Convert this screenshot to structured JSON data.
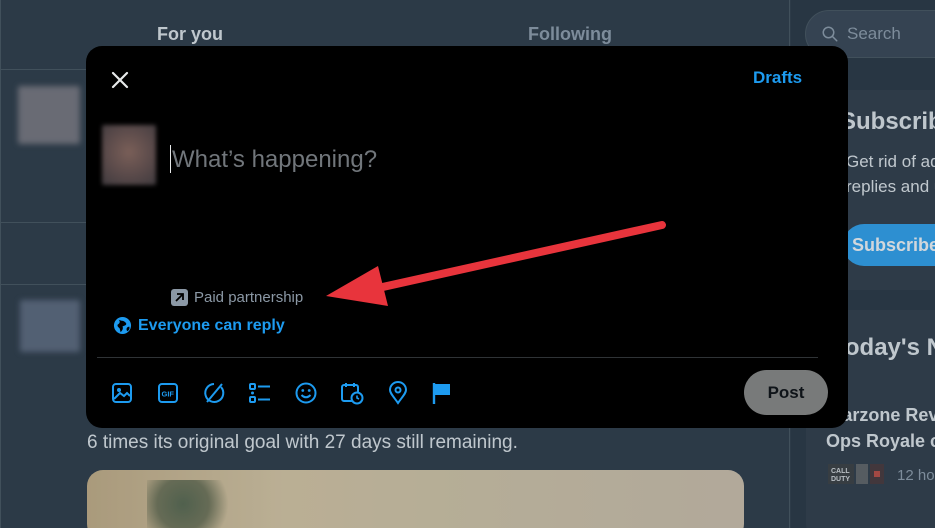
{
  "timeline": {
    "tabs": [
      {
        "label": "For you"
      },
      {
        "label": "Following"
      }
    ],
    "post_text": "6 times its original goal with 27 days still remaining."
  },
  "sidebar": {
    "search_placeholder": "Search",
    "subscribe": {
      "title": "Subscribe",
      "line1": "Get rid of ad",
      "line2": "replies and u",
      "button": "Subscribe"
    },
    "today": {
      "title": "Today's N",
      "headline1": "Warzone Rev",
      "headline2": "Ops Royale c",
      "meta": "12 ho"
    }
  },
  "compose": {
    "drafts_label": "Drafts",
    "placeholder": "What’s happening?",
    "paid_partnership": "Paid partnership",
    "reply_setting": "Everyone can reply",
    "post_button": "Post",
    "toolbar_icons": [
      "image-icon",
      "gif-icon",
      "grok-icon",
      "poll-icon",
      "emoji-icon",
      "schedule-icon",
      "location-icon",
      "flag-icon"
    ]
  },
  "colors": {
    "accent": "#1d9bf0",
    "annotation_arrow": "#e8343c",
    "modal_bg": "#000000",
    "post_button_disabled": "#787a7a"
  }
}
